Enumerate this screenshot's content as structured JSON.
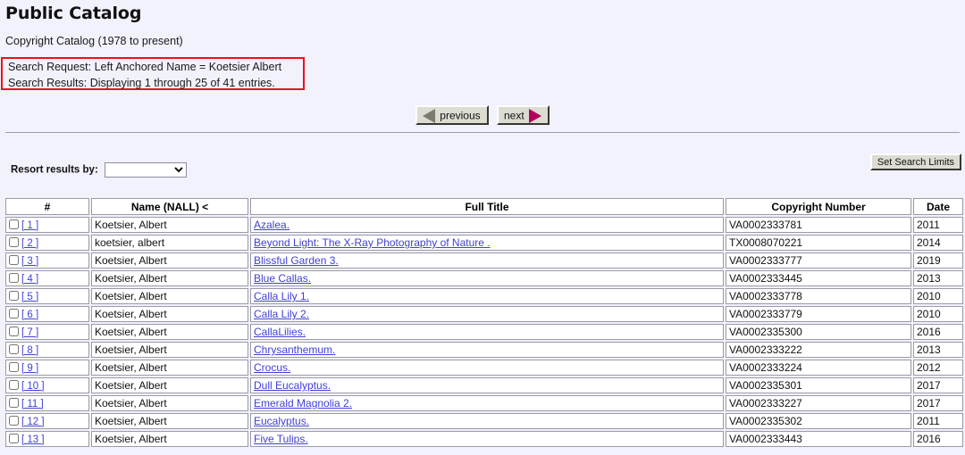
{
  "page": {
    "title": "Public Catalog",
    "catalog_line": "Copyright Catalog (1978 to present)",
    "search_request": "Search Request: Left Anchored Name = Koetsier Albert",
    "search_results": "Search Results: Displaying 1 through 25 of 41 entries.",
    "highlight_color": "#ee1111"
  },
  "nav": {
    "previous_label": "previous",
    "next_label": "next",
    "previous_icon": "triangle-left-icon",
    "next_icon": "triangle-right-icon",
    "previous_icon_color": "#7b7b70",
    "next_icon_color": "#b4005a"
  },
  "controls": {
    "resort_label": "Resort results by:",
    "resort_selected": "",
    "resort_options": [
      ""
    ],
    "set_search_limits_label": "Set Search Limits"
  },
  "table": {
    "headers": [
      "#",
      "Name (NALL) <",
      "Full Title",
      "Copyright Number",
      "Date"
    ],
    "rows": [
      {
        "index": "[ 1 ]",
        "name": "Koetsier, Albert",
        "title": "Azalea.",
        "copyright": "VA0002333781",
        "date": "2011"
      },
      {
        "index": "[ 2 ]",
        "name": "koetsier, albert",
        "title": "Beyond Light: The X-Ray Photography of Nature .",
        "copyright": "TX0008070221",
        "date": "2014"
      },
      {
        "index": "[ 3 ]",
        "name": "Koetsier, Albert",
        "title": "Blissful Garden 3.",
        "copyright": "VA0002333777",
        "date": "2019"
      },
      {
        "index": "[ 4 ]",
        "name": "Koetsier, Albert",
        "title": "Blue Callas.",
        "copyright": "VA0002333445",
        "date": "2013"
      },
      {
        "index": "[ 5 ]",
        "name": "Koetsier, Albert",
        "title": "Calla Lily 1.",
        "copyright": "VA0002333778",
        "date": "2010"
      },
      {
        "index": "[ 6 ]",
        "name": "Koetsier, Albert",
        "title": "Calla Lily 2.",
        "copyright": "VA0002333779",
        "date": "2010"
      },
      {
        "index": "[ 7 ]",
        "name": "Koetsier, Albert",
        "title": "CallaLilies.",
        "copyright": "VA0002335300",
        "date": "2016"
      },
      {
        "index": "[ 8 ]",
        "name": "Koetsier, Albert",
        "title": "Chrysanthemum.",
        "copyright": "VA0002333222",
        "date": "2013"
      },
      {
        "index": "[ 9 ]",
        "name": "Koetsier, Albert",
        "title": "Crocus.",
        "copyright": "VA0002333224",
        "date": "2012"
      },
      {
        "index": "[ 10 ]",
        "name": "Koetsier, Albert",
        "title": "Dull Eucalyptus.",
        "copyright": "VA0002335301",
        "date": "2017"
      },
      {
        "index": "[ 11 ]",
        "name": "Koetsier, Albert",
        "title": "Emerald Magnolia 2.",
        "copyright": "VA0002333227",
        "date": "2017"
      },
      {
        "index": "[ 12 ]",
        "name": "Koetsier, Albert",
        "title": "Eucalyptus.",
        "copyright": "VA0002335302",
        "date": "2011"
      },
      {
        "index": "[ 13 ]",
        "name": "Koetsier, Albert",
        "title": "Five Tulips.",
        "copyright": "VA0002333443",
        "date": "2016"
      }
    ]
  }
}
